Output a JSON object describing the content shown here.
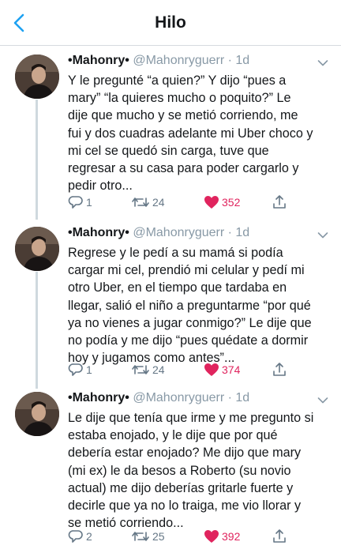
{
  "header": {
    "title": "Hilo",
    "back_icon": "chevron-left-icon"
  },
  "colors": {
    "accent": "#1da1f2",
    "like": "#e0245e",
    "muted": "#657786"
  },
  "tweets": [
    {
      "name": "•Mahonry•",
      "handle": "@Mahonryguerr",
      "dot": "·",
      "time": "1d",
      "lines": [
        "Y le pregunté “a quien?” Y dijo “pues a",
        "mary” “la quieres mucho o poquito?” Le",
        "dije que mucho y se metió corriendo, me",
        "fui y dos cuadras adelante mi Uber choco y",
        "mi cel se quedó sin carga, tuve que",
        "regresar a su casa para poder cargarlo y",
        "pedir otro..."
      ],
      "replies": "1",
      "retweets": "24",
      "likes": "352"
    },
    {
      "name": "•Mahonry•",
      "handle": "@Mahonryguerr",
      "dot": "·",
      "time": "1d",
      "lines": [
        "Regrese y le pedí a su mamá si podía",
        "cargar mi cel, prendió mi celular y pedí mi",
        "otro Uber, en el tiempo que tardaba en",
        "llegar, salió el niño a preguntarme “por qué",
        "ya no vienes a jugar conmigo?” Le dije que",
        "no podía y me dijo “pues quédate a dormir",
        "hoy y jugamos como antes”..."
      ],
      "replies": "1",
      "retweets": "24",
      "likes": "374"
    },
    {
      "name": "•Mahonry•",
      "handle": "@Mahonryguerr",
      "dot": "·",
      "time": "1d",
      "lines": [
        "Le dije que tenía que irme y me pregunto si",
        "estaba enojado, y le dije que por qué",
        "debería estar enojado? Me dijo que mary",
        "(mi ex) le da besos a Roberto (su novio",
        "actual) me dijo deberías gritarle fuerte y",
        "decirle que ya no lo traiga, me vio llorar y",
        "se metió corriendo..."
      ],
      "replies": "2",
      "retweets": "25",
      "likes": "392"
    }
  ]
}
